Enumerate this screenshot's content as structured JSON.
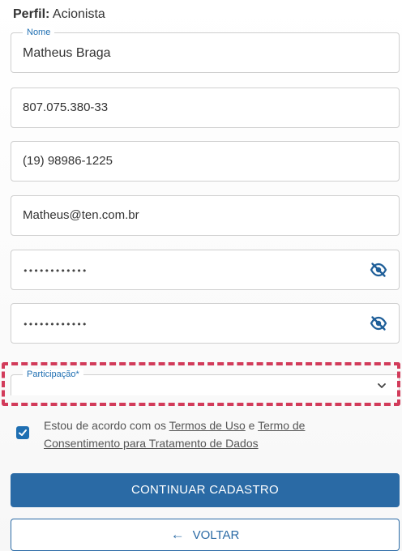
{
  "profile": {
    "label": "Perfil:",
    "value": "Acionista"
  },
  "form": {
    "name": {
      "label": "Nome",
      "value": "Matheus Braga"
    },
    "cpf": {
      "value": "807.075.380-33"
    },
    "phone": {
      "value": "(19) 98986-1225"
    },
    "email": {
      "value": "Matheus@ten.com.br"
    },
    "password": {
      "value": "••••••••••••",
      "toggle_icon": "eye-off-icon"
    },
    "password_confirm": {
      "value": "••••••••••••",
      "toggle_icon": "eye-off-icon"
    },
    "participation": {
      "label": "Participação*",
      "value": "",
      "dropdown_icon": "chevron-down-icon"
    }
  },
  "agreement": {
    "checked": true,
    "text_prefix": "Estou de acordo com os ",
    "terms_of_use": "Termos de Uso",
    "connector": " e ",
    "consent_terms": "Termo de Consentimento para Tratamento de Dados"
  },
  "buttons": {
    "continue_label": "CONTINUAR CADASTRO",
    "back_label": "VOLTAR",
    "back_icon": "arrow-left-icon"
  },
  "colors": {
    "primary": "#2a6aa5",
    "highlight": "#d23b5a",
    "label_accent": "#1f6fb2"
  }
}
